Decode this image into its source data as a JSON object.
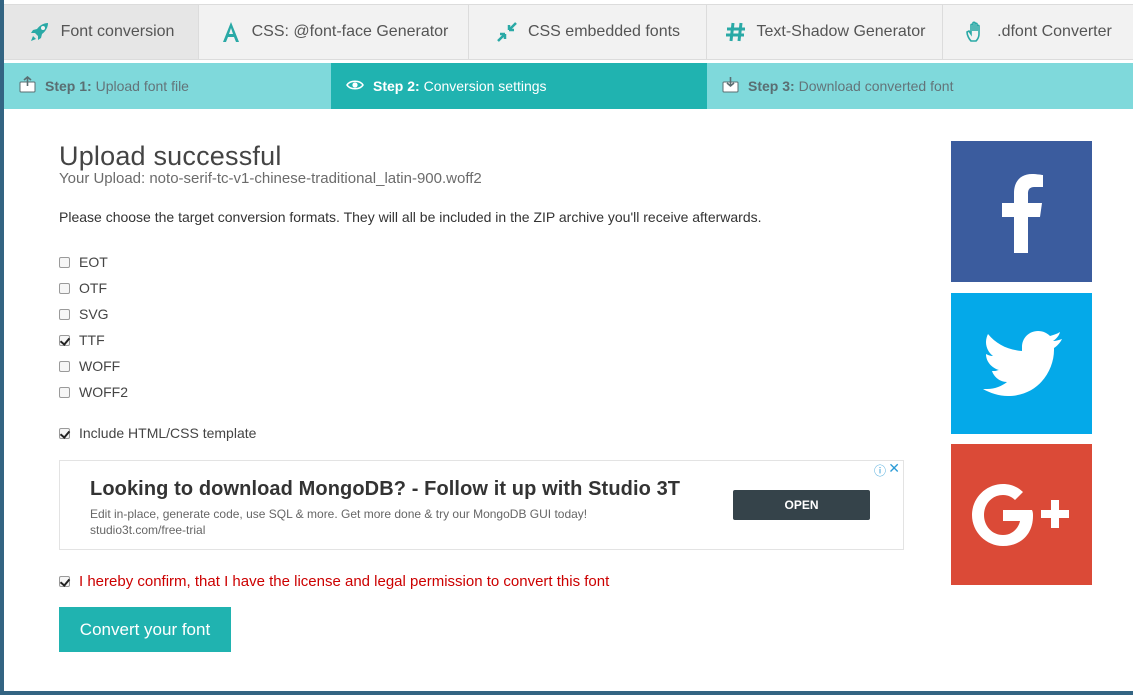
{
  "tabs": [
    {
      "label": "Font conversion",
      "icon": "rocket-icon"
    },
    {
      "label": "CSS: @font-face Generator",
      "icon": "letter-a-icon"
    },
    {
      "label": "CSS embedded fonts",
      "icon": "compress-arrows-icon"
    },
    {
      "label": "Text-Shadow Generator",
      "icon": "hash-icon"
    },
    {
      "label": ".dfont Converter",
      "icon": "hand-icon"
    }
  ],
  "steps": [
    {
      "num": "Step 1:",
      "text": "Upload font file",
      "icon": "upload-icon"
    },
    {
      "num": "Step 2:",
      "text": "Conversion settings",
      "icon": "eye-icon"
    },
    {
      "num": "Step 3:",
      "text": "Download converted font",
      "icon": "download-icon"
    }
  ],
  "main": {
    "title": "Upload successful",
    "upload_line": "Your Upload: noto-serif-tc-v1-chinese-traditional_latin-900.woff2",
    "instructions": "Please choose the target conversion formats. They will all be included in the ZIP archive you'll receive afterwards.",
    "formats": [
      {
        "label": "EOT",
        "checked": false
      },
      {
        "label": "OTF",
        "checked": false
      },
      {
        "label": "SVG",
        "checked": false
      },
      {
        "label": "TTF",
        "checked": true
      },
      {
        "label": "WOFF",
        "checked": false
      },
      {
        "label": "WOFF2",
        "checked": false
      }
    ],
    "template_label": "Include HTML/CSS template",
    "template_checked": true,
    "confirm_label": "I hereby confirm, that I have the license and legal permission to convert this font",
    "confirm_checked": true,
    "convert_button": "Convert your font"
  },
  "ad": {
    "title": "Looking to download MongoDB? - Follow it up with Studio 3T",
    "description": "Edit in-place, generate code, use SQL & more. Get more done & try our MongoDB GUI today!",
    "url": "studio3t.com/free-trial",
    "button": "OPEN"
  },
  "social": [
    "facebook-icon",
    "twitter-icon",
    "google-plus-icon"
  ],
  "colors": {
    "accent": "#20b3b0",
    "step_bg": "#7fd9db",
    "facebook": "#3b5c9e",
    "twitter": "#04a9e9",
    "google_plus": "#db4a37",
    "warning": "#cc0000"
  }
}
